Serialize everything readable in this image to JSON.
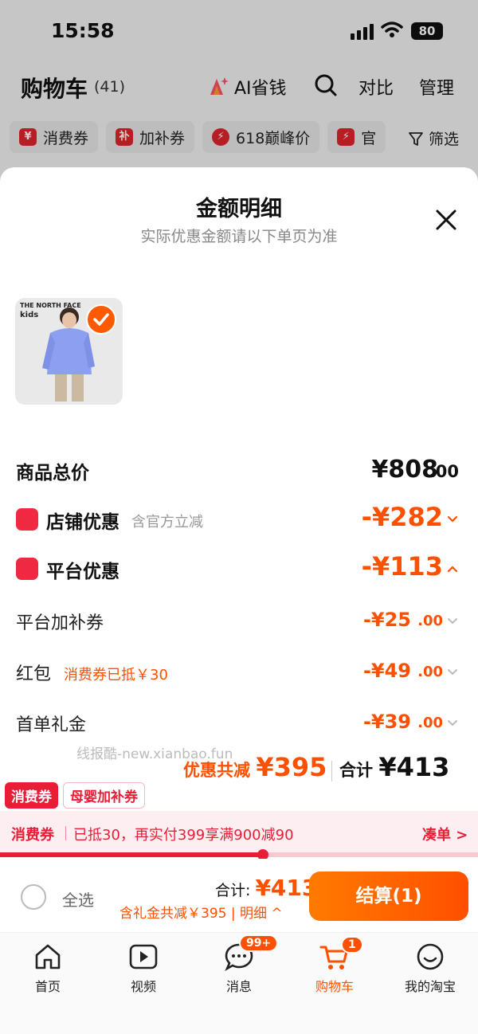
{
  "status_bar": {
    "time": "15:58",
    "battery": "80"
  },
  "header": {
    "title": "购物车",
    "count": "(41)",
    "ai_label": "AI省钱",
    "compare": "对比",
    "manage": "管理"
  },
  "chips": [
    {
      "icon_char": "¥",
      "label": "消费券"
    },
    {
      "icon_char": "补",
      "label": "加补券"
    },
    {
      "icon_char": "⚡",
      "label": "618巅峰价"
    },
    {
      "icon_char": "⚡",
      "label": "官"
    }
  ],
  "filter_label": "筛选",
  "sheet": {
    "title": "金额明细",
    "subtitle": "实际优惠金额请以下单页为准",
    "product_brand": "THE NORTH FACE",
    "product_brand_sub": "kids",
    "rows": {
      "total": {
        "label": "商品总价",
        "value": "¥808",
        "decimal": ".00"
      },
      "shop": {
        "label": "店铺优惠",
        "hint": "含官方立减",
        "value": "-¥282"
      },
      "platform": {
        "label": "平台优惠",
        "value": "-¥113"
      },
      "subsidy": {
        "label": "平台加补券",
        "value": "-¥25",
        "decimal": ".00"
      },
      "redpacket": {
        "label": "红包",
        "hint": "消费券已抵￥30",
        "value": "-¥49",
        "decimal": ".00"
      },
      "gift": {
        "label": "首单礼金",
        "value": "-¥39",
        "decimal": ".00"
      }
    },
    "watermark": "线报酷-new.xianbao.fun",
    "savings_label": "优惠共减",
    "savings_value": "¥395",
    "total_label": "合计",
    "total_value": "¥413"
  },
  "coupon_tags": [
    "消费券",
    "母婴加补券"
  ],
  "coupon_bar": {
    "label": "消费券",
    "message": "已抵30，再实付399享满900减90",
    "action": "凑单 >",
    "progress": 0.55
  },
  "checkout": {
    "select_all": "全选",
    "sum_label": "合计:",
    "sum_value": "¥413",
    "sum_sub": "含礼金共减￥395 | 明细 ^",
    "pay_label": "结算(1)"
  },
  "tabs": [
    {
      "label": "首页",
      "icon": "home-icon"
    },
    {
      "label": "视频",
      "icon": "video-icon"
    },
    {
      "label": "消息",
      "icon": "message-icon",
      "badge": "99+"
    },
    {
      "label": "购物车",
      "icon": "cart-icon",
      "badge": "1",
      "active": true
    },
    {
      "label": "我的淘宝",
      "icon": "profile-icon"
    }
  ],
  "colors": {
    "accent": "#ff5000",
    "red": "#ea1d36"
  }
}
